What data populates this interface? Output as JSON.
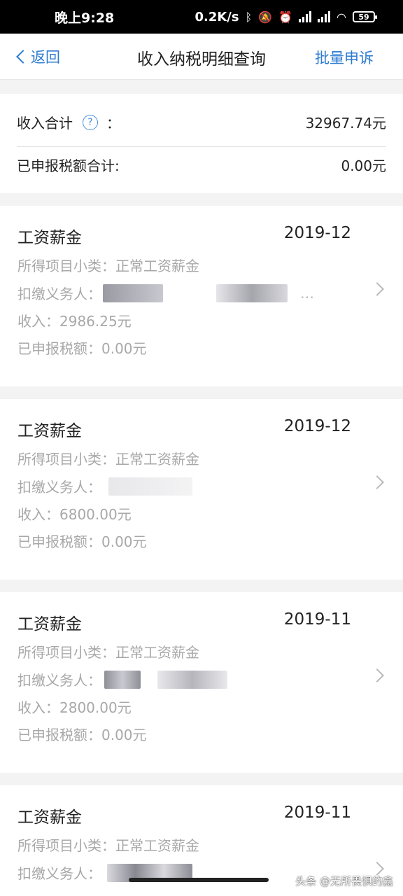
{
  "status_bar": {
    "time": "晚上9:28",
    "speed": "0.2K/s",
    "battery": "59",
    "icons": [
      "bluetooth-icon",
      "mute-bell-icon",
      "alarm-icon",
      "signal-hd-icon",
      "signal-hd-icon",
      "wifi-icon",
      "battery-icon"
    ]
  },
  "nav": {
    "back_label": "返回",
    "title": "收入纳税明细查询",
    "action_label": "批量申诉"
  },
  "summary": {
    "income_label": "收入合计",
    "income_colon": "：",
    "income_value": "32967.74元",
    "tax_label": "已申报税额合计:",
    "tax_value": "0.00元"
  },
  "records": [
    {
      "title": "工资薪金",
      "date": "2019-12",
      "subtype": "所得项目小类：正常工资薪金",
      "withholder_label": "扣缴义务人：",
      "income": "收入：2986.25元",
      "tax": "已申报税额：0.00元"
    },
    {
      "title": "工资薪金",
      "date": "2019-12",
      "subtype": "所得项目小类：正常工资薪金",
      "withholder_label": "扣缴义务人：",
      "income": "收入：6800.00元",
      "tax": "已申报税额：0.00元"
    },
    {
      "title": "工资薪金",
      "date": "2019-11",
      "subtype": "所得项目小类：正常工资薪金",
      "withholder_label": "扣缴义务人：",
      "income": "收入：2800.00元",
      "tax": "已申报税额：0.00元"
    },
    {
      "title": "工资薪金",
      "date": "2019-11",
      "subtype": "所得项目小类：正常工资薪金",
      "withholder_label": "扣缴义务人："
    }
  ],
  "watermark": "头条 @无所畏惧的鑫"
}
